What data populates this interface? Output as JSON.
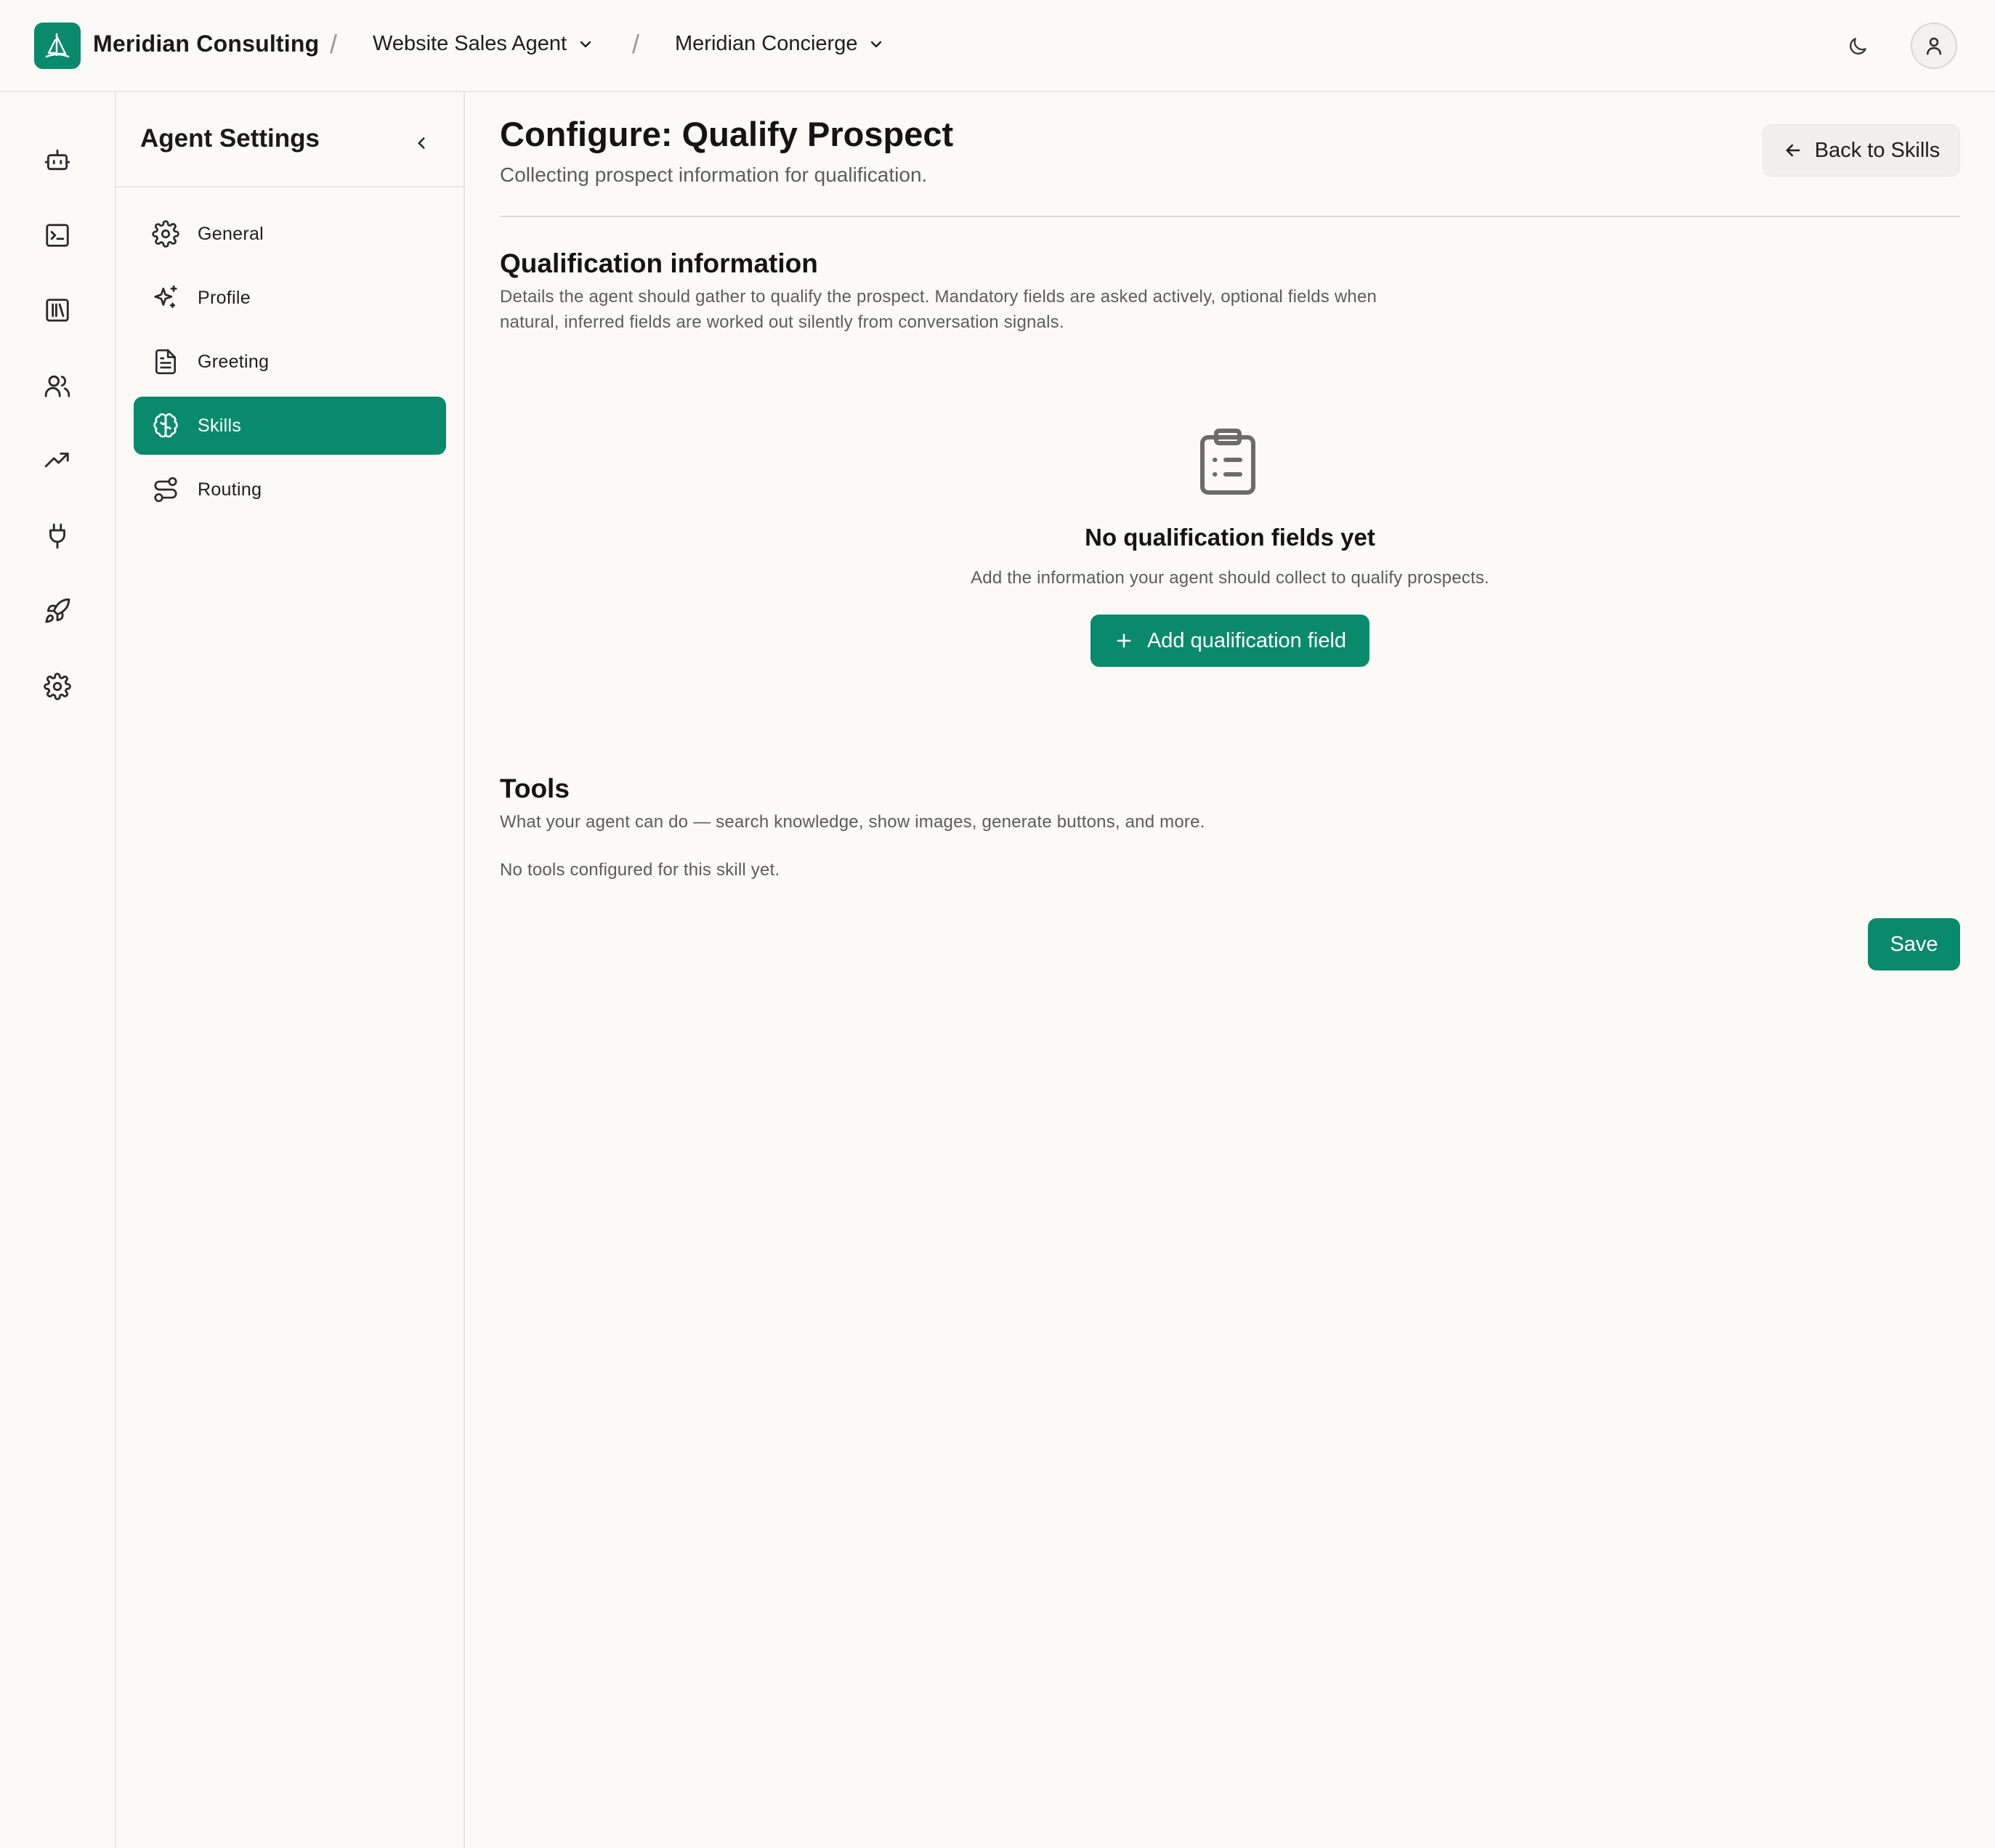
{
  "header": {
    "org_name": "Meridian Consulting",
    "separator": "/",
    "agent": "Website Sales Agent",
    "persona": "Meridian Concierge"
  },
  "rail": {
    "items": [
      {
        "icon": "robot-icon"
      },
      {
        "icon": "terminal-icon"
      },
      {
        "icon": "library-icon"
      },
      {
        "icon": "users-icon"
      },
      {
        "icon": "trending-up-icon"
      },
      {
        "icon": "plug-icon"
      },
      {
        "icon": "rocket-icon"
      },
      {
        "icon": "settings-gear-icon"
      }
    ]
  },
  "sidebar": {
    "title": "Agent Settings",
    "items": [
      {
        "label": "General",
        "icon": "gear-icon"
      },
      {
        "label": "Profile",
        "icon": "sparkles-icon"
      },
      {
        "label": "Greeting",
        "icon": "document-icon"
      },
      {
        "label": "Skills",
        "icon": "brain-icon",
        "active": true
      },
      {
        "label": "Routing",
        "icon": "route-icon"
      }
    ]
  },
  "main": {
    "title": "Configure: Qualify Prospect",
    "subtitle": "Collecting prospect information for qualification.",
    "back_label": "Back to Skills",
    "qualification": {
      "title": "Qualification information",
      "desc_line1": "Details the agent should gather to qualify the prospect. Mandatory fields are asked actively, optional fields when",
      "desc_line2": "natural, inferred fields are worked out silently from conversation signals.",
      "empty_title": "No qualification fields yet",
      "empty_desc": "Add the information your agent should collect to qualify prospects.",
      "add_label": "Add qualification field"
    },
    "tools": {
      "title": "Tools",
      "desc": "What your agent can do — search knowledge, show images, generate buttons, and more.",
      "empty": "No tools configured for this skill yet."
    },
    "save_label": "Save"
  },
  "colors": {
    "accent": "#0a8a6c",
    "background": "#fcfaf7",
    "border": "#e9e6e1",
    "muted_text": "#5e5c57"
  }
}
